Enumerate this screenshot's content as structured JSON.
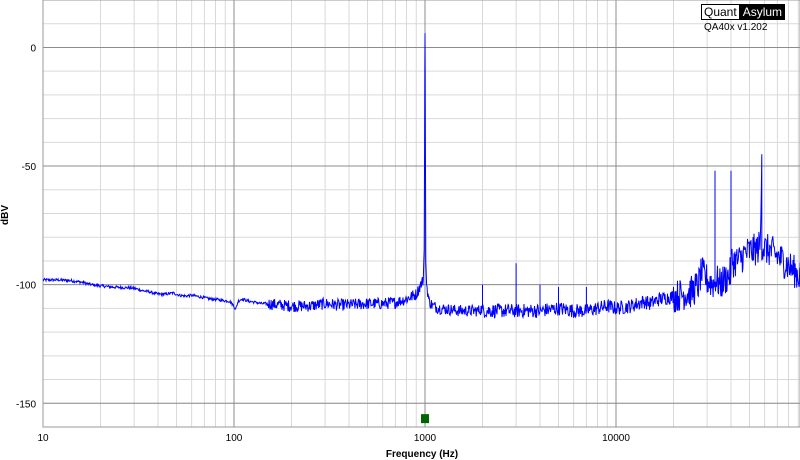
{
  "branding": {
    "name_part1": "Quant",
    "name_part2": "Asylum",
    "version": "QA40x v1.202"
  },
  "chart_data": {
    "type": "line",
    "title": "",
    "xlabel": "Frequency (Hz)",
    "ylabel": "dBV",
    "x_scale": "log",
    "xlim": [
      10,
      96000
    ],
    "ylim": [
      -160,
      20
    ],
    "x_ticks": [
      {
        "value": 10,
        "label": "10"
      },
      {
        "value": 100,
        "label": "100"
      },
      {
        "value": 1000,
        "label": "1000"
      },
      {
        "value": 10000,
        "label": "10000"
      }
    ],
    "y_ticks": [
      {
        "value": 0,
        "label": "0"
      },
      {
        "value": -50,
        "label": "-50"
      },
      {
        "value": -100,
        "label": "-100"
      },
      {
        "value": -150,
        "label": "-150"
      }
    ],
    "grid": true,
    "line_color": "#0000ff",
    "marker": {
      "x": 1000,
      "y": -155,
      "color": "#006400"
    },
    "series": [
      {
        "values": [
          [
            10,
            -98
          ],
          [
            12,
            -98
          ],
          [
            14,
            -98.3
          ],
          [
            16,
            -99
          ],
          [
            18,
            -100
          ],
          [
            20,
            -100.5
          ],
          [
            23,
            -101
          ],
          [
            26,
            -101.2
          ],
          [
            28,
            -101.3
          ],
          [
            30,
            -101.5
          ],
          [
            33,
            -102.5
          ],
          [
            36,
            -103
          ],
          [
            40,
            -104
          ],
          [
            44,
            -104
          ],
          [
            48,
            -103.5
          ],
          [
            52,
            -104.5
          ],
          [
            56,
            -104.8
          ],
          [
            60,
            -104.5
          ],
          [
            65,
            -105
          ],
          [
            70,
            -105.5
          ],
          [
            75,
            -106
          ],
          [
            80,
            -106.2
          ],
          [
            85,
            -106.5
          ],
          [
            90,
            -106.8
          ],
          [
            95,
            -107
          ],
          [
            100,
            -109
          ],
          [
            102,
            -110.5
          ],
          [
            105,
            -107
          ],
          [
            110,
            -106
          ],
          [
            120,
            -107
          ],
          [
            130,
            -107.5
          ],
          [
            140,
            -108
          ],
          [
            150,
            -108
          ],
          [
            170,
            -108.5
          ],
          [
            200,
            -109
          ],
          [
            250,
            -109
          ],
          [
            300,
            -108
          ],
          [
            350,
            -108.5
          ],
          [
            400,
            -108.5
          ],
          [
            500,
            -108
          ],
          [
            600,
            -108
          ],
          [
            700,
            -107.5
          ],
          [
            800,
            -106
          ],
          [
            900,
            -104
          ],
          [
            950,
            -100
          ],
          [
            980,
            -98
          ],
          [
            990,
            -85
          ],
          [
            995,
            -40
          ],
          [
            998,
            -10
          ],
          [
            1000,
            6
          ],
          [
            1002,
            -10
          ],
          [
            1005,
            -40
          ],
          [
            1010,
            -90
          ],
          [
            1020,
            -100
          ],
          [
            1050,
            -107
          ],
          [
            1100,
            -109
          ],
          [
            1200,
            -110
          ],
          [
            1500,
            -111
          ],
          [
            1900,
            -111
          ],
          [
            2000,
            -110
          ],
          [
            2000,
            -100
          ],
          [
            2000,
            -111
          ],
          [
            2500,
            -111
          ],
          [
            3000,
            -111
          ],
          [
            3000,
            -91
          ],
          [
            3000,
            -111
          ],
          [
            3500,
            -111
          ],
          [
            4000,
            -111
          ],
          [
            4000,
            -100
          ],
          [
            4000,
            -111
          ],
          [
            5000,
            -110
          ],
          [
            5000,
            -101
          ],
          [
            5000,
            -110
          ],
          [
            6000,
            -111
          ],
          [
            7000,
            -111
          ],
          [
            7000,
            -101
          ],
          [
            7000,
            -111
          ],
          [
            8000,
            -110
          ],
          [
            9000,
            -109
          ],
          [
            10000,
            -110
          ],
          [
            12000,
            -109
          ],
          [
            13000,
            -108
          ],
          [
            14000,
            -107
          ],
          [
            15000,
            -108
          ],
          [
            17000,
            -106
          ],
          [
            20000,
            -105
          ],
          [
            25000,
            -103
          ],
          [
            27000,
            -100
          ],
          [
            28000,
            -95
          ],
          [
            30000,
            -98
          ],
          [
            33000,
            -100
          ],
          [
            33000,
            -52
          ],
          [
            33000,
            -97
          ],
          [
            35000,
            -100
          ],
          [
            40000,
            -95
          ],
          [
            40000,
            -52
          ],
          [
            40000,
            -90
          ],
          [
            44000,
            -90
          ],
          [
            47000,
            -87
          ],
          [
            50000,
            -86
          ],
          [
            55000,
            -85
          ],
          [
            57000,
            -83
          ],
          [
            58000,
            -45
          ],
          [
            58000,
            -83
          ],
          [
            60000,
            -85
          ],
          [
            65000,
            -86
          ],
          [
            70000,
            -88
          ],
          [
            75000,
            -90
          ],
          [
            80000,
            -92
          ],
          [
            85000,
            -94
          ],
          [
            90000,
            -96
          ],
          [
            96000,
            -98
          ]
        ]
      }
    ]
  }
}
